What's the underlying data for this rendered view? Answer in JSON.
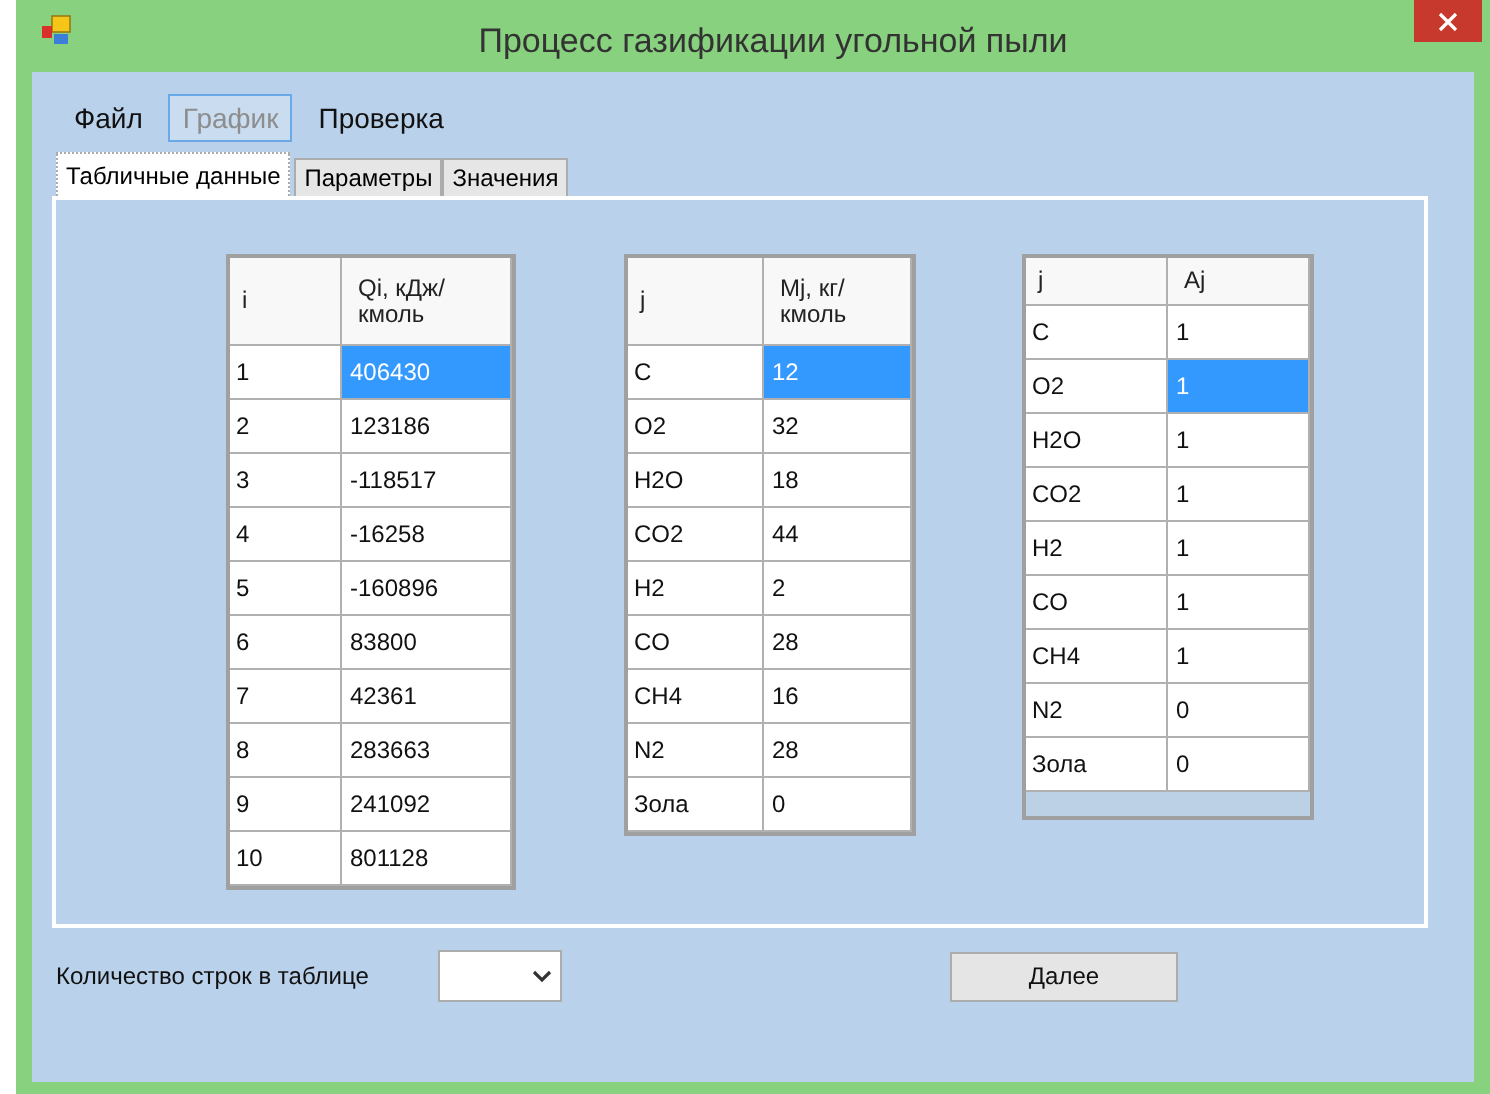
{
  "window": {
    "title": "Процесс газификации угольной пыли"
  },
  "menu": [
    {
      "label": "Файл",
      "disabled": false,
      "hovered": false
    },
    {
      "label": "График",
      "disabled": true,
      "hovered": true
    },
    {
      "label": "Проверка",
      "disabled": false,
      "hovered": false
    }
  ],
  "tabs": [
    {
      "label": "Табличные данные",
      "selected": true
    },
    {
      "label": "Параметры",
      "selected": false
    },
    {
      "label": "Значения",
      "selected": false
    }
  ],
  "tables": [
    {
      "columns": [
        "i",
        "Qi, кДж/кмоль"
      ],
      "rows": [
        {
          "key": "1",
          "value": "406430",
          "selected": true
        },
        {
          "key": "2",
          "value": "123186",
          "selected": false
        },
        {
          "key": "3",
          "value": "-118517",
          "selected": false
        },
        {
          "key": "4",
          "value": "-16258",
          "selected": false
        },
        {
          "key": "5",
          "value": "-160896",
          "selected": false
        },
        {
          "key": "6",
          "value": "83800",
          "selected": false
        },
        {
          "key": "7",
          "value": "42361",
          "selected": false
        },
        {
          "key": "8",
          "value": "283663",
          "selected": false
        },
        {
          "key": "9",
          "value": "241092",
          "selected": false
        },
        {
          "key": "10",
          "value": "801128",
          "selected": false
        }
      ]
    },
    {
      "columns": [
        "j",
        "Mj, кг/кмоль"
      ],
      "rows": [
        {
          "key": "C",
          "value": "12",
          "selected": true
        },
        {
          "key": "O2",
          "value": "32",
          "selected": false
        },
        {
          "key": "H2O",
          "value": "18",
          "selected": false
        },
        {
          "key": "CO2",
          "value": "44",
          "selected": false
        },
        {
          "key": "H2",
          "value": "2",
          "selected": false
        },
        {
          "key": "CO",
          "value": "28",
          "selected": false
        },
        {
          "key": "CH4",
          "value": "16",
          "selected": false
        },
        {
          "key": "N2",
          "value": "28",
          "selected": false
        },
        {
          "key": "Зола",
          "value": "0",
          "selected": false
        }
      ]
    },
    {
      "columns": [
        "j",
        "Aj"
      ],
      "rows": [
        {
          "key": "C",
          "value": "1",
          "selected": false
        },
        {
          "key": "O2",
          "value": "1",
          "selected": true
        },
        {
          "key": "H2O",
          "value": "1",
          "selected": false
        },
        {
          "key": "CO2",
          "value": "1",
          "selected": false
        },
        {
          "key": "H2",
          "value": "1",
          "selected": false
        },
        {
          "key": "CO",
          "value": "1",
          "selected": false
        },
        {
          "key": "CH4",
          "value": "1",
          "selected": false
        },
        {
          "key": "N2",
          "value": "0",
          "selected": false
        },
        {
          "key": "Зола",
          "value": "0",
          "selected": false
        }
      ]
    }
  ],
  "row_count": {
    "label": "Количество строк в таблице"
  },
  "next_button": {
    "label": "Далее"
  }
}
